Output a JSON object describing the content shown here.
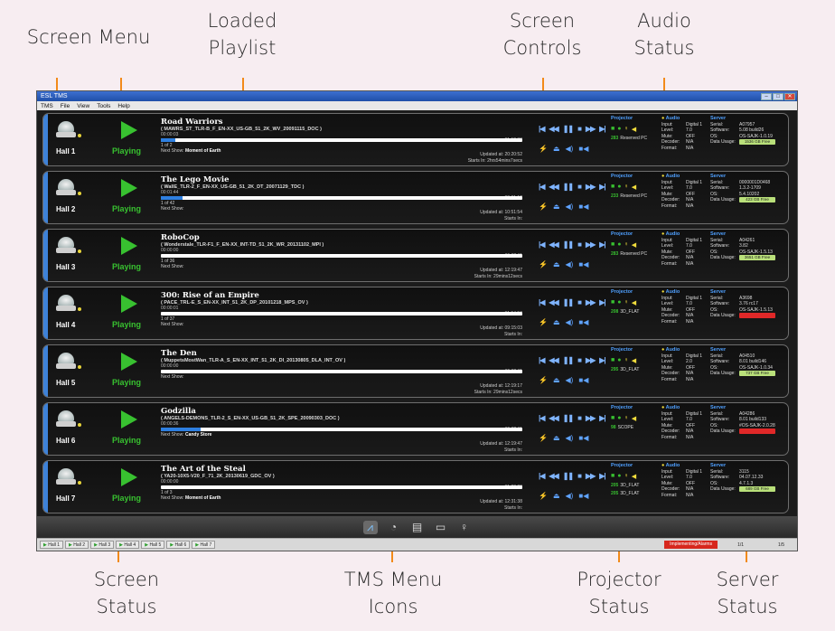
{
  "callouts": {
    "screen_menu": "Screen Menu",
    "loaded_playlist": "Loaded\nPlaylist",
    "screen_controls": "Screen\nControls",
    "audio_status": "Audio\nStatus",
    "screen_status": "Screen\nStatus",
    "tms_menu_icons": "TMS Menu\nIcons",
    "projector_status": "Projector\nStatus",
    "server_status": "Server\nStatus"
  },
  "window": {
    "title": "ESL TMS",
    "menu": [
      "TMS",
      "File",
      "View",
      "Tools",
      "Help"
    ]
  },
  "labels": {
    "projector": "Projector",
    "audio": "Audio",
    "server": "Server",
    "input": "Input:",
    "level": "Level:",
    "mute": "Mute:",
    "decoder": "Decoder:",
    "format": "Format:",
    "serial": "Serial:",
    "software": "Software:",
    "os": "OS:",
    "data_usage": "Data Usage:",
    "next_show": "Next Show:",
    "starts_in": "Starts In:"
  },
  "halls": [
    {
      "name": "Hall 1",
      "status": "Playing",
      "title": "Road Warriors",
      "cpl": "( MAWRS_ST_TLR-B_F_EN-XX_US-GB_51_2K_WV_20091115_DOC )",
      "elapsed": "00:00:03",
      "remain": "-01:12:33",
      "progress": 0.04,
      "count": "1 of 2",
      "next": "Moment of Earth",
      "updated": "Updated at: 20:20:52",
      "starts": "Starts In:  2hrs54mins7secs",
      "proj_mode_num": "283",
      "proj_mode": "Reserved PC",
      "audio_input": "Digital 1",
      "audio_level": "7.0",
      "audio_mute": "OFF",
      "audio_decoder": "N/A",
      "audio_format": "N/A",
      "serial": "A07957",
      "software": "5.08 build26",
      "os": "OS-SAJK-1.0.19",
      "free": "1536 GB Free",
      "free_red": false
    },
    {
      "name": "Hall 2",
      "status": "Playing",
      "title": "The Lego Movie",
      "cpl": "( WallE_TLR-2_F_EN-XX_US-GB_51_2K_DT_20071129_TDC )",
      "elapsed": "00:01:44",
      "remain": "-00:01:12",
      "progress": 0.06,
      "count": "1 of 42",
      "next": "",
      "updated": "Updated at: 10:51:54",
      "starts": "Starts In:",
      "proj_mode_num": "233",
      "proj_mode": "Reserved PC",
      "audio_input": "Digital 1",
      "audio_level": "7.0",
      "audio_mute": "OFF",
      "audio_decoder": "N/A",
      "audio_format": "N/A",
      "serial": "0000001D0468",
      "software": "1.3.2-1709",
      "os": "5.4.10202",
      "free": "423 GB Free",
      "free_red": false
    },
    {
      "name": "Hall 3",
      "status": "Playing",
      "title": "RoboCop",
      "cpl": "( Wonderstale_TLR-F1_F_EN-XX_INT-TD_51_2K_WR_20131102_MPI )",
      "elapsed": "00:00:00",
      "remain": "-01:28:11",
      "progress": 0.0,
      "count": "1 of 36",
      "next": "",
      "updated": "Updated at: 12:19:47",
      "starts": "Starts In:  29mins12secs",
      "proj_mode_num": "283",
      "proj_mode": "Reserved PC",
      "audio_input": "Digital 1",
      "audio_level": "7.0",
      "audio_mute": "OFF",
      "audio_decoder": "N/A",
      "audio_format": "N/A",
      "serial": "A04261",
      "software": "3.82",
      "os": "OS-SAJK-1.5.13",
      "free": "3651 GB Free",
      "free_red": false
    },
    {
      "name": "Hall 4",
      "status": "Playing",
      "title": "300: Rise of an Empire",
      "cpl": "( PACE_TRL-E_S_EN-XX_INT_51_2K_DP_20101218_MPS_OV )",
      "elapsed": "00:00:01",
      "remain": "-01:54:56",
      "progress": 0.0,
      "count": "1 of 37",
      "next": "",
      "updated": "Updated at: 09:15:03",
      "starts": "Starts In:",
      "proj_mode_num": "208",
      "proj_mode": "3D_FLAT",
      "audio_input": "Digital 1",
      "audio_level": "7.0",
      "audio_mute": "OFF",
      "audio_decoder": "N/A",
      "audio_format": "N/A",
      "serial": "A3698",
      "software": "3.76 rc17",
      "os": "OS-SAJK-1.5.13",
      "free": "",
      "free_red": true
    },
    {
      "name": "Hall 5",
      "status": "Playing",
      "title": "The Den",
      "cpl": "( MuppetsMostWan_TLR-A_S_EN-XX_INT_51_2K_DI_20130805_DLA_INT_OV )",
      "elapsed": "00:00:00",
      "remain": "-01:20:11",
      "progress": 0.0,
      "count": "",
      "next": "",
      "updated": "Updated at: 12:19:17",
      "starts": "Starts In:  29mins12secs",
      "proj_mode_num": "295",
      "proj_mode": "3D_FLAT",
      "audio_input": "Digital 1",
      "audio_level": "2.0",
      "audio_mute": "OFF",
      "audio_decoder": "N/A",
      "audio_format": "N/A",
      "serial": "A04510",
      "software": "8.01 build146",
      "os": "OS-SAJK-1.0.34",
      "free": "737 GB Free",
      "free_red": false
    },
    {
      "name": "Hall 6",
      "status": "Playing",
      "title": "Godzilla",
      "cpl": "( ANGELS-DEMONS_TLR-2_S_EN-XX_US-GB_51_2K_SPE_20090303_DOC )",
      "elapsed": "00:00:36",
      "remain": "-01:28:11",
      "progress": 0.11,
      "count": "",
      "next": "Candy Store",
      "updated": "Updated at: 12:19:47",
      "starts": "Starts In:",
      "proj_mode_num": "98",
      "proj_mode": "SCOPE",
      "audio_input": "Digital 1",
      "audio_level": "7.0",
      "audio_mute": "OFF",
      "audio_decoder": "N/A",
      "audio_format": "N/A",
      "serial": "A04286",
      "software": "8.01 build133",
      "os": "#OS-SAJK-2.0.28",
      "free": "",
      "free_red": true
    },
    {
      "name": "Hall 7",
      "status": "Playing",
      "title": "The Art of the Steal",
      "cpl": "( YA20-10X5-V20_F_71_2K_20130619_GDC_OV )",
      "elapsed": "00:00:00",
      "remain": "-01:22:29",
      "progress": 0.0,
      "count": "1 of 3",
      "next": "Moment of Earth",
      "updated": "Updated at: 12:31:38",
      "starts": "Starts In:",
      "proj_mode_num": "205",
      "proj_mode": "3D_FLAT",
      "proj_mode2_num": "205",
      "proj_mode2": "3D_FLAT",
      "audio_input": "Digital 1",
      "audio_level": "7.0",
      "audio_mute": "OFF",
      "audio_decoder": "N/A",
      "audio_format": "N/A",
      "serial": "3115",
      "software": "04.07.12.33",
      "os": "4.7.1.3",
      "free": "689 GB Free",
      "free_red": false
    }
  ],
  "taskbar": {
    "halls": [
      "Hall 1",
      "Hall 2",
      "Hall 3",
      "Hall 4",
      "Hall 5",
      "Hall 6",
      "Hall 7"
    ],
    "alert": "Implementing/Alarms",
    "page1": "1/1",
    "page2": "1/5"
  },
  "colors": {
    "accent_blue": "#3e82d8",
    "playing_green": "#38c130",
    "callout_line": "#f28a1a",
    "alert_red": "#d7271d"
  }
}
